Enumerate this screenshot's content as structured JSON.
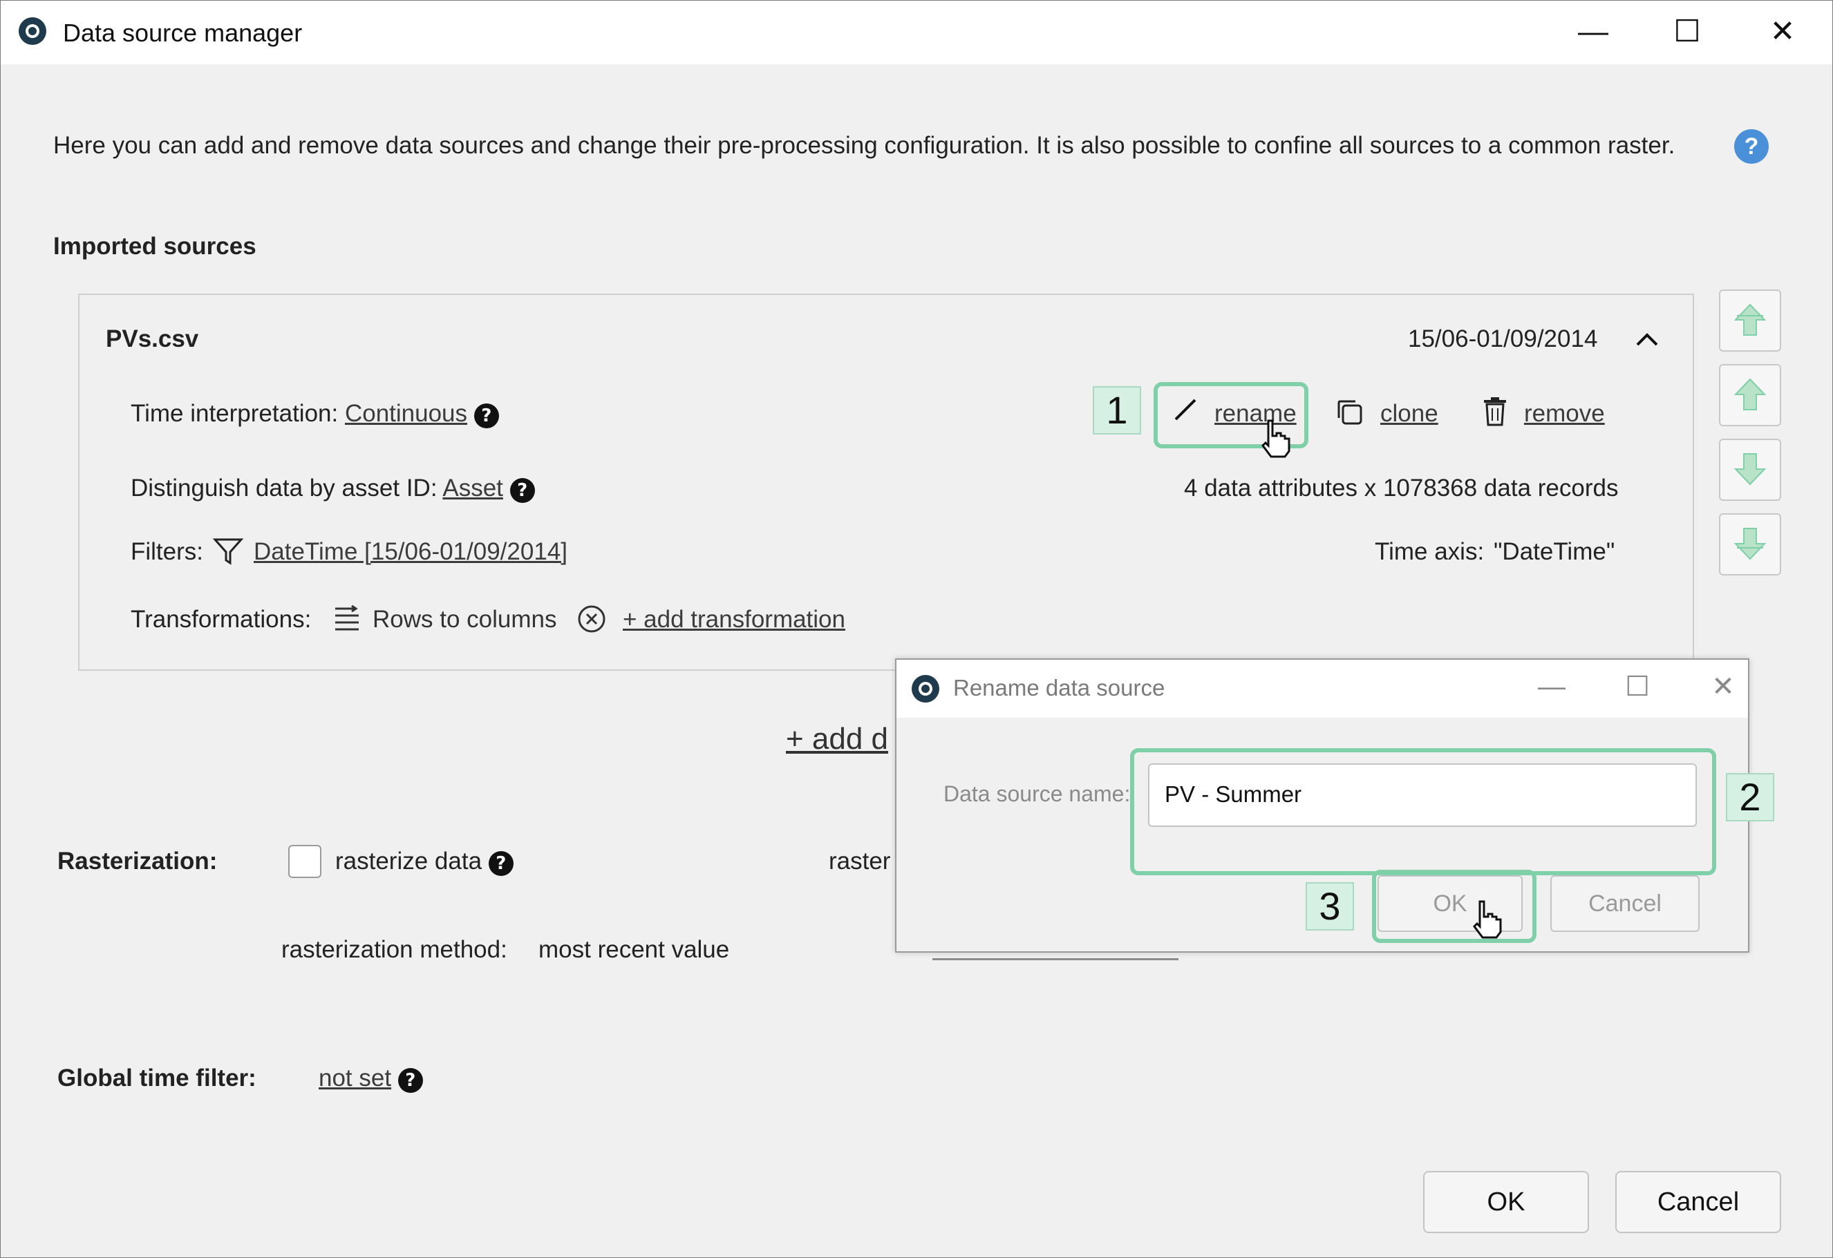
{
  "window": {
    "title": "Data source manager"
  },
  "description": "Here you can add and remove data sources and change their pre-processing configuration. It is also possible to confine all sources to a common raster.",
  "imported_label": "Imported sources",
  "source": {
    "name": "PVs.csv",
    "date_range": "15/06-01/09/2014",
    "time_interp_label": "Time interpretation:",
    "time_interp_value": "Continuous",
    "asset_label": "Distinguish data by asset ID:",
    "asset_value": "Asset",
    "filters_label": "Filters:",
    "filter_value": "DateTime [15/06-01/09/2014]",
    "transform_label": "Transformations:",
    "transform_value": "Rows to columns",
    "add_transform": "+ add transformation",
    "rename": "rename",
    "clone": "clone",
    "remove": "remove",
    "stats": "4 data attributes x 1078368 data records",
    "time_axis_label": "Time axis:",
    "time_axis_value": "\"DateTime\""
  },
  "add_data_source_partial": "+ add d",
  "rasterization": {
    "label": "Rasterization:",
    "checkbox_label": "rasterize data",
    "raster_partial": "raster",
    "method_label": "rasterization method:",
    "method_value": "most recent value"
  },
  "global_filter": {
    "label": "Global time filter:",
    "value": "not set"
  },
  "buttons": {
    "ok": "OK",
    "cancel": "Cancel"
  },
  "rename_dialog": {
    "title": "Rename data source",
    "field_label": "Data source name:",
    "field_value": "PV - Summer",
    "ok": "OK",
    "cancel": "Cancel"
  },
  "callouts": [
    "1",
    "2",
    "3"
  ],
  "accent_color": "#7fcfa9"
}
